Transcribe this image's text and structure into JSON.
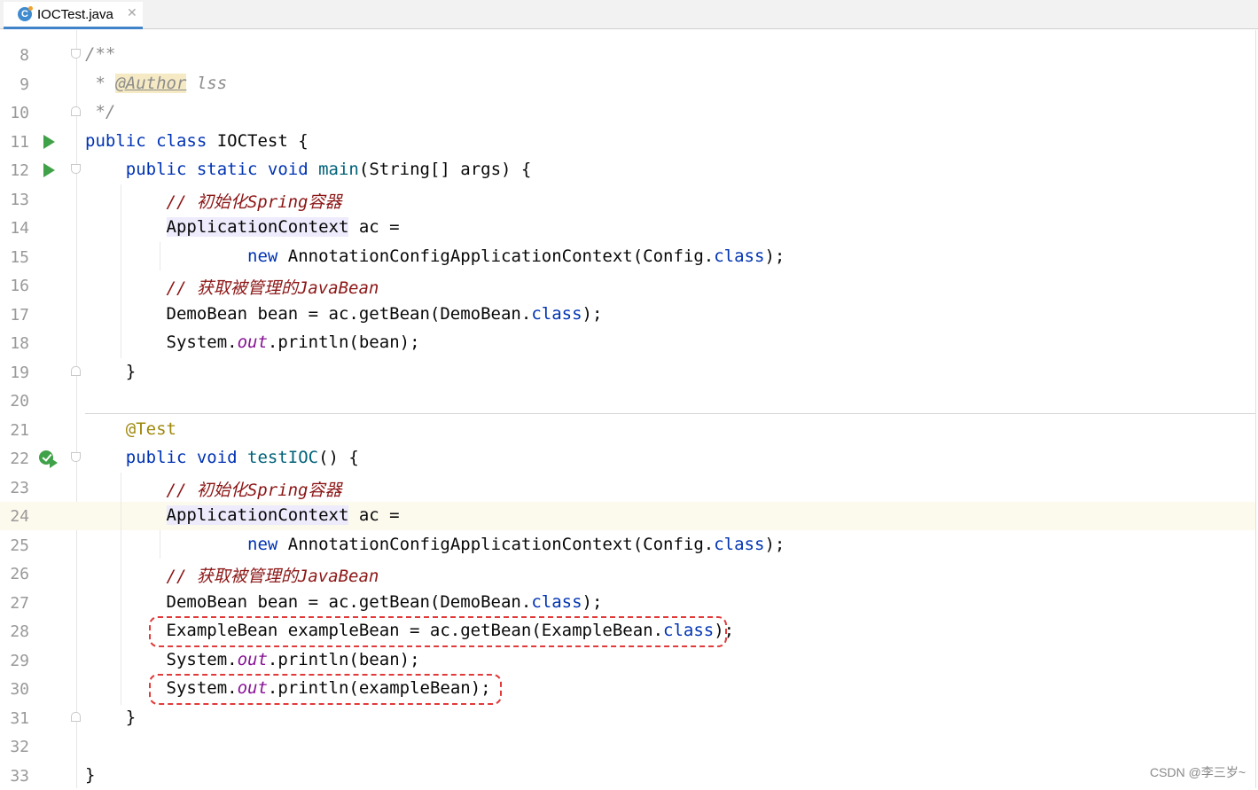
{
  "tab": {
    "filename": "IOCTest.java",
    "icon_letter": "C",
    "close_glyph": "✕"
  },
  "watermark": "CSDN @李三岁~",
  "lines": [
    {
      "n": "8",
      "segments": [
        {
          "t": "/**",
          "c": "cm"
        }
      ]
    },
    {
      "n": "9",
      "segments": [
        {
          "t": " * ",
          "c": "cm"
        },
        {
          "t": "@Author",
          "c": "tag"
        },
        {
          "t": " lss",
          "c": "cm"
        }
      ]
    },
    {
      "n": "10",
      "segments": [
        {
          "t": " */",
          "c": "cm"
        }
      ]
    },
    {
      "n": "11",
      "segments": [
        {
          "t": "public class ",
          "c": "kw"
        },
        {
          "t": "IOCTest {",
          "c": ""
        }
      ]
    },
    {
      "n": "12",
      "segments": [
        {
          "t": "    public static void ",
          "c": "kw"
        },
        {
          "t": "main",
          "c": "fn"
        },
        {
          "t": "(String[] args) {",
          "c": ""
        }
      ]
    },
    {
      "n": "13",
      "segments": [
        {
          "t": "        // 初始化Spring容器",
          "c": "cmr"
        }
      ]
    },
    {
      "n": "14",
      "segments": [
        {
          "t": "        ",
          "c": ""
        },
        {
          "t": "ApplicationContext",
          "c": "hl"
        },
        {
          "t": " ac =",
          "c": ""
        }
      ]
    },
    {
      "n": "15",
      "segments": [
        {
          "t": "                ",
          "c": ""
        },
        {
          "t": "new ",
          "c": "kw"
        },
        {
          "t": "AnnotationConfigApplicationContext(Config.",
          "c": ""
        },
        {
          "t": "class",
          "c": "kw"
        },
        {
          "t": ");",
          "c": ""
        }
      ]
    },
    {
      "n": "16",
      "segments": [
        {
          "t": "        // 获取被管理的JavaBean",
          "c": "cmr"
        }
      ]
    },
    {
      "n": "17",
      "segments": [
        {
          "t": "        DemoBean bean = ac.getBean(DemoBean.",
          "c": ""
        },
        {
          "t": "class",
          "c": "kw"
        },
        {
          "t": ");",
          "c": ""
        }
      ]
    },
    {
      "n": "18",
      "segments": [
        {
          "t": "        System.",
          "c": ""
        },
        {
          "t": "out",
          "c": "st"
        },
        {
          "t": ".println(bean);",
          "c": ""
        }
      ]
    },
    {
      "n": "19",
      "segments": [
        {
          "t": "    }",
          "c": ""
        }
      ]
    },
    {
      "n": "20",
      "segments": []
    },
    {
      "n": "21",
      "segments": [
        {
          "t": "    @Test",
          "c": "an"
        }
      ]
    },
    {
      "n": "22",
      "segments": [
        {
          "t": "    public void ",
          "c": "kw"
        },
        {
          "t": "testIOC",
          "c": "fn"
        },
        {
          "t": "() {",
          "c": ""
        }
      ]
    },
    {
      "n": "23",
      "segments": [
        {
          "t": "        // 初始化Spring容器",
          "c": "cmr"
        }
      ]
    },
    {
      "n": "24",
      "segments": [
        {
          "t": "        ",
          "c": ""
        },
        {
          "t": "ApplicationContext",
          "c": "hl"
        },
        {
          "t": " ac =",
          "c": ""
        }
      ]
    },
    {
      "n": "25",
      "segments": [
        {
          "t": "                ",
          "c": ""
        },
        {
          "t": "new ",
          "c": "kw"
        },
        {
          "t": "AnnotationConfigApplicationContext(Config.",
          "c": ""
        },
        {
          "t": "class",
          "c": "kw"
        },
        {
          "t": ");",
          "c": ""
        }
      ]
    },
    {
      "n": "26",
      "segments": [
        {
          "t": "        // 获取被管理的JavaBean",
          "c": "cmr"
        }
      ]
    },
    {
      "n": "27",
      "segments": [
        {
          "t": "        DemoBean bean = ac.getBean(DemoBean.",
          "c": ""
        },
        {
          "t": "class",
          "c": "kw"
        },
        {
          "t": ");",
          "c": ""
        }
      ]
    },
    {
      "n": "28",
      "segments": [
        {
          "t": "        ExampleBean exampleBean = ac.getBean(ExampleBean.",
          "c": ""
        },
        {
          "t": "class",
          "c": "kw"
        },
        {
          "t": ");",
          "c": ""
        }
      ]
    },
    {
      "n": "29",
      "segments": [
        {
          "t": "        System.",
          "c": ""
        },
        {
          "t": "out",
          "c": "st"
        },
        {
          "t": ".println(bean);",
          "c": ""
        }
      ]
    },
    {
      "n": "30",
      "segments": [
        {
          "t": "        System.",
          "c": ""
        },
        {
          "t": "out",
          "c": "st"
        },
        {
          "t": ".println(exampleBean);",
          "c": ""
        }
      ]
    },
    {
      "n": "31",
      "segments": [
        {
          "t": "    }",
          "c": ""
        }
      ]
    },
    {
      "n": "32",
      "segments": []
    },
    {
      "n": "33",
      "segments": [
        {
          "t": "}",
          "c": ""
        }
      ]
    }
  ],
  "current_line": "24",
  "highlighted_lines": [
    "28",
    "30"
  ],
  "colors": {
    "keyword": "#0033b3",
    "method": "#00627a",
    "comment": "#8c8c8c",
    "annotation": "#9e880d",
    "static_field": "#871094",
    "highlight_box": "#e03a3a",
    "run_icon": "#3fa148"
  },
  "gutter_icons": {
    "11": "run-icon",
    "12": "run-icon",
    "22": "run-test-icon"
  },
  "fold_markers": {
    "8": "fold-open-icon",
    "10": "fold-close-icon",
    "12": "fold-open-icon",
    "19": "fold-close-icon",
    "22": "fold-open-icon",
    "31": "fold-close-icon"
  }
}
